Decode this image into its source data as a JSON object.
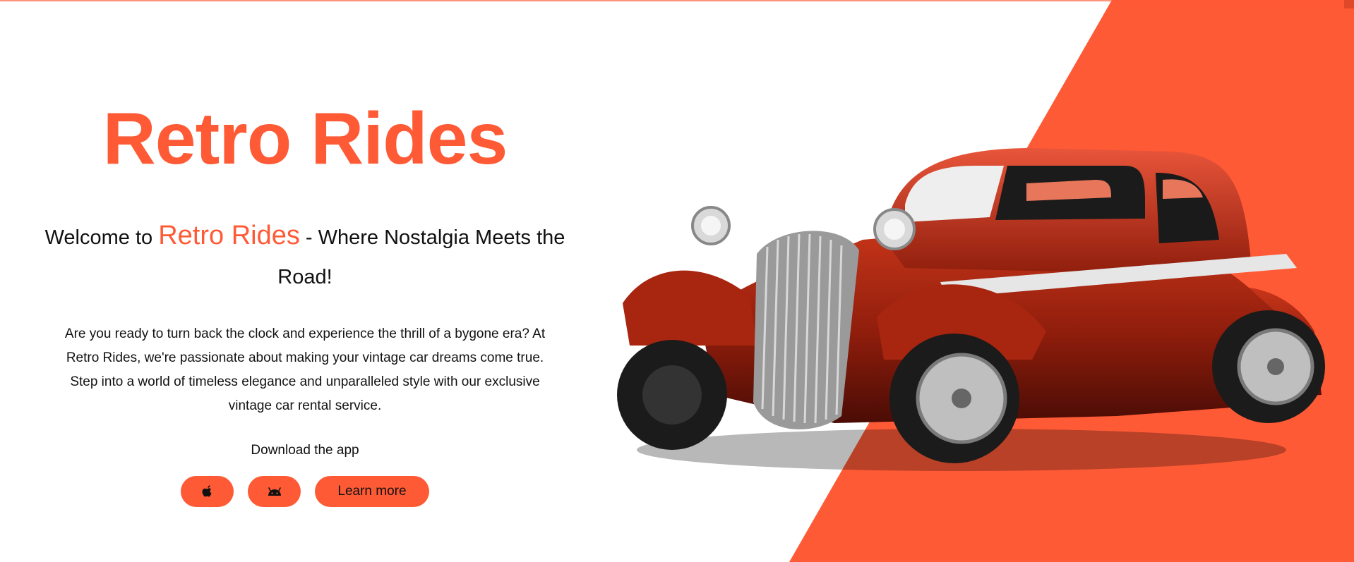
{
  "theme": {
    "accent": "#ff5a36",
    "text": "#111111",
    "background": "#ffffff"
  },
  "hero": {
    "title": "Retro Rides",
    "subtitle_prefix": "Welcome to ",
    "subtitle_brand": "Retro Rides",
    "subtitle_suffix": " - Where Nostalgia Meets the Road!",
    "intro": "Are you ready to turn back the clock and experience the thrill of a bygone era? At Retro Rides, we're passionate about making your vintage car dreams come true. Step into a world of timeless elegance and unparalleled style with our exclusive vintage car rental service.",
    "download_label": "Download the app",
    "buttons": {
      "ios_icon": "apple-icon",
      "android_icon": "android-icon",
      "learn_more": "Learn more"
    }
  },
  "image": {
    "subject": "red vintage hot rod coupe"
  }
}
